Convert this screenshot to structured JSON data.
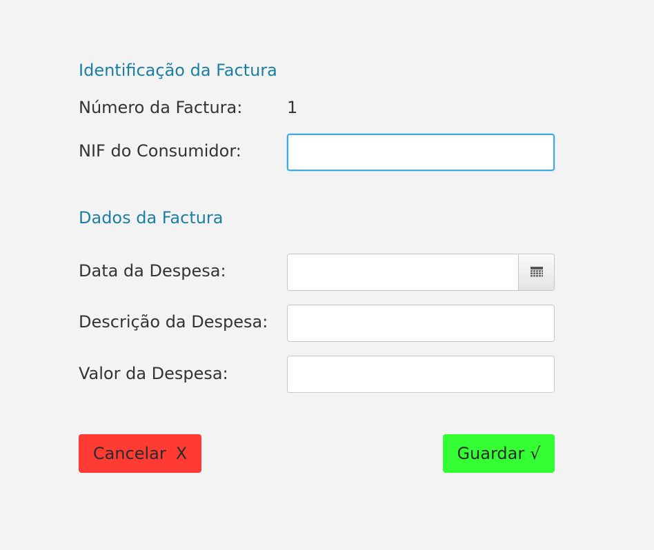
{
  "sections": {
    "identification_title": "Identificação da Factura",
    "data_title": "Dados da Factura"
  },
  "fields": {
    "invoice_number": {
      "label": "Número da Factura:",
      "value": "1"
    },
    "consumer_nif": {
      "label": "NIF do Consumidor:",
      "value": "",
      "placeholder": ""
    },
    "expense_date": {
      "label": "Data da Despesa:",
      "value": "",
      "placeholder": ""
    },
    "expense_description": {
      "label": "Descrição da Despesa:",
      "value": "",
      "placeholder": ""
    },
    "expense_value": {
      "label": "Valor da Despesa:",
      "value": "",
      "placeholder": ""
    }
  },
  "buttons": {
    "cancel": {
      "label": "Cancelar",
      "symbol": "X"
    },
    "save": {
      "label": "Guardar",
      "symbol": "√"
    }
  },
  "icons": {
    "date_picker": "calendar-icon"
  },
  "colors": {
    "section_title": "#1b7fa3",
    "cancel_bg": "#ff3b33",
    "save_bg": "#33ff33",
    "focus_border": "#3fa9e0",
    "background": "#f3f3f3"
  }
}
